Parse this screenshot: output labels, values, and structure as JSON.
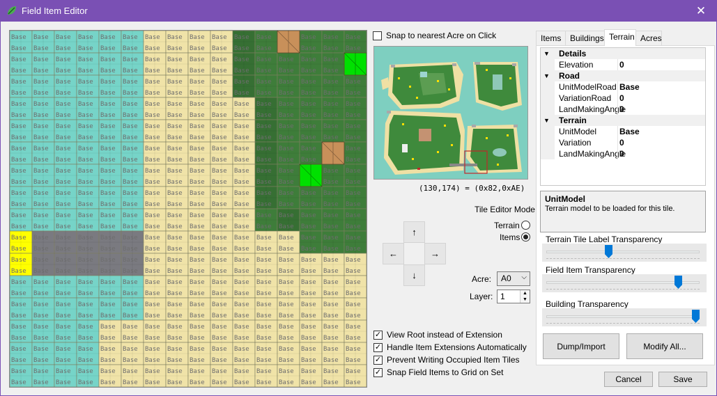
{
  "window": {
    "title": "Field Item Editor",
    "close_glyph": "✕",
    "accent": "#7a50b4"
  },
  "grid": {
    "tile_label": "Base",
    "cols": 16,
    "rows": 16,
    "terrain_colors": {
      "water": "#76d4c8",
      "sand": "#f0e3a8",
      "grass": "#3e7d3a",
      "grass_dark": "#366f33",
      "rock": "#7a7a80",
      "selected": "#ffff00",
      "item_green": "#00e000",
      "item_brown": "#c8905a"
    }
  },
  "snap_to_acre": {
    "label": "Snap to nearest Acre on Click",
    "checked": false
  },
  "coordinates": "(130,174) = (0x82,0xAE)",
  "tile_editor_mode": {
    "label": "Tile Editor Mode",
    "options": [
      {
        "label": "Terrain",
        "selected": false
      },
      {
        "label": "Items",
        "selected": true
      }
    ]
  },
  "arrows": {
    "up": "↑",
    "left": "←",
    "right": "→",
    "down": "↓"
  },
  "acre": {
    "label": "Acre:",
    "value": "A0"
  },
  "layer": {
    "label": "Layer:",
    "value": "1"
  },
  "options": [
    {
      "label": "View Root instead of Extension",
      "checked": true
    },
    {
      "label": "Handle Item Extensions Automatically",
      "checked": true
    },
    {
      "label": "Prevent Writing Occupied Item Tiles",
      "checked": true
    },
    {
      "label": "Snap Field Items to Grid on Set",
      "checked": true
    }
  ],
  "tabs": [
    "Items",
    "Buildings",
    "Terrain",
    "Acres"
  ],
  "active_tab": "Terrain",
  "property_grid": {
    "categories": [
      {
        "name": "Details",
        "props": [
          {
            "name": "Elevation",
            "value": "0"
          }
        ]
      },
      {
        "name": "Road",
        "props": [
          {
            "name": "UnitModelRoad",
            "value": "Base"
          },
          {
            "name": "VariationRoad",
            "value": "0"
          },
          {
            "name": "LandMakingAngle",
            "value": "0"
          }
        ]
      },
      {
        "name": "Terrain",
        "props": [
          {
            "name": "UnitModel",
            "value": "Base"
          },
          {
            "name": "Variation",
            "value": "0"
          },
          {
            "name": "LandMakingAngle",
            "value": "0"
          }
        ]
      }
    ]
  },
  "help": {
    "title": "UnitModel",
    "description": "Terrain model to be loaded for this tile."
  },
  "sliders": [
    {
      "label": "Terrain Tile Label Transparency",
      "value": 0.4
    },
    {
      "label": "Field Item Transparency",
      "value": 0.88
    },
    {
      "label": "Building Transparency",
      "value": 1.0
    }
  ],
  "buttons": {
    "dump": "Dump/Import",
    "modify": "Modify All...",
    "cancel": "Cancel",
    "save": "Save"
  }
}
